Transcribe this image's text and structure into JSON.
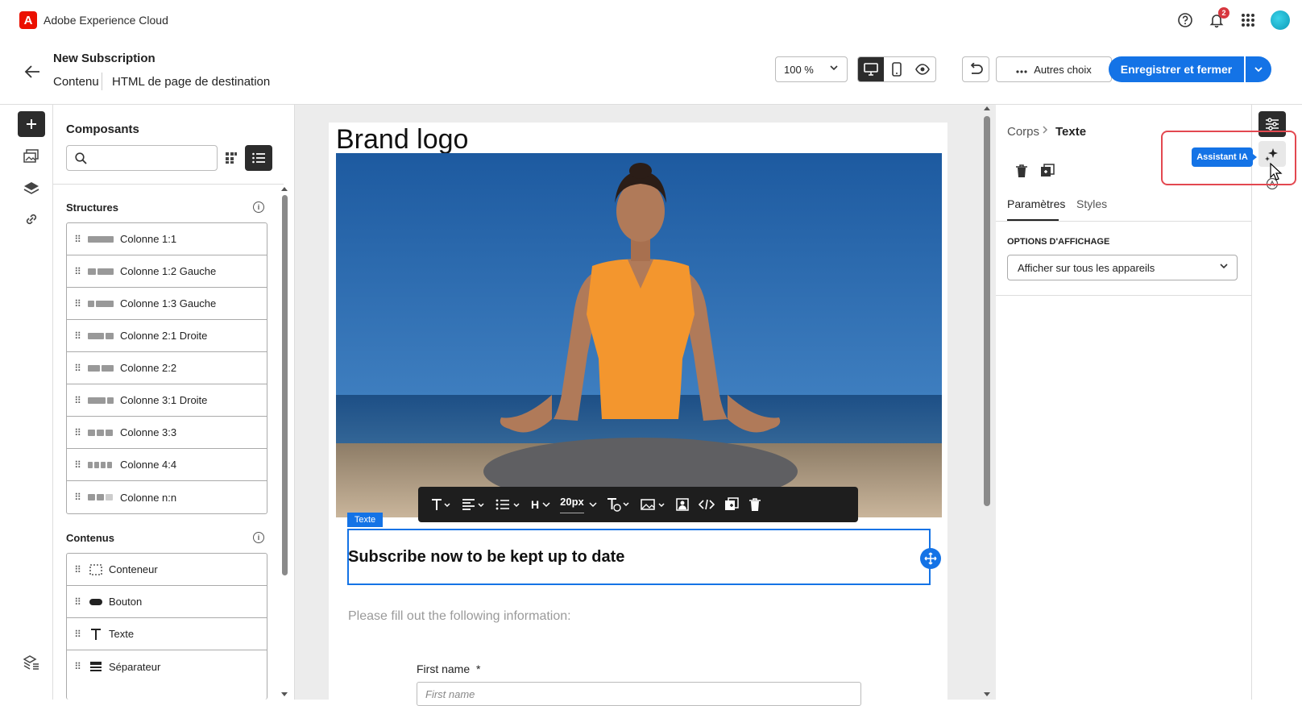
{
  "topbar": {
    "logo_letter": "A",
    "app_name": "Adobe Experience Cloud",
    "notification_count": "2",
    "icons": [
      "help-icon",
      "bell-icon",
      "apps-grid-icon",
      "avatar"
    ]
  },
  "header": {
    "title": "New Subscription",
    "breadcrumb": [
      "Contenu",
      "HTML de page de destination"
    ],
    "zoom": "100 %",
    "more_label": "Autres choix",
    "save_label": "Enregistrer et fermer"
  },
  "components": {
    "title": "Composants",
    "search_placeholder": "",
    "structures_title": "Structures",
    "structures": [
      {
        "label": "Colonne 1:1"
      },
      {
        "label": "Colonne 1:2 Gauche"
      },
      {
        "label": "Colonne 1:3 Gauche"
      },
      {
        "label": "Colonne 2:1 Droite"
      },
      {
        "label": "Colonne 2:2"
      },
      {
        "label": "Colonne 3:1 Droite"
      },
      {
        "label": "Colonne 3:3"
      },
      {
        "label": "Colonne 4:4"
      },
      {
        "label": "Colonne n:n"
      }
    ],
    "contents_title": "Contenus",
    "contents": [
      {
        "label": "Conteneur",
        "icon": "container-icon"
      },
      {
        "label": "Bouton",
        "icon": "button-icon"
      },
      {
        "label": "Texte",
        "icon": "text-icon"
      },
      {
        "label": "Séparateur",
        "icon": "divider-icon"
      }
    ]
  },
  "canvas": {
    "brand_logo": "Brand logo",
    "font_size": "20px",
    "heading_letter": "H",
    "selected_tag": "Texte",
    "headline": "Subscribe now to be kept up to date",
    "info_line": "Please fill out the following information:",
    "field_label": "First name",
    "field_required": "*",
    "field_placeholder": "First name"
  },
  "properties": {
    "crumb_parent": "Corps",
    "crumb_current": "Texte",
    "tab_params": "Paramètres",
    "tab_styles": "Styles",
    "display_options_label": "OPTIONS D'AFFICHAGE",
    "display_option_value": "Afficher sur tous les appareils"
  },
  "ai_tooltip": "Assistant IA",
  "colors": {
    "accent": "#1473e6",
    "brand_red": "#eb1000",
    "highlight": "#e34850",
    "dark": "#2c2c2c"
  }
}
